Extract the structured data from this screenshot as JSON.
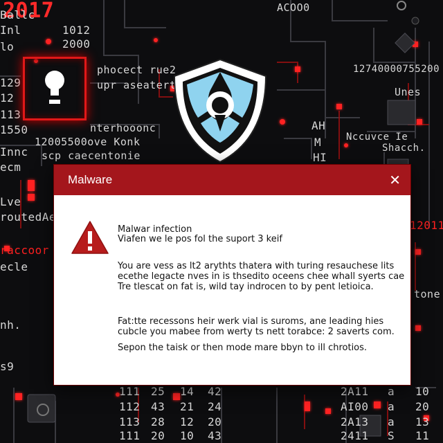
{
  "background": {
    "year": "2017",
    "corner_top_right": "ACOO0",
    "lines_left": [
      "Ballc",
      "Inl",
      "lo",
      "129",
      "12",
      "113",
      "1550",
      "Innc",
      "ecm",
      "Lve",
      "routedAec",
      "raccoor",
      "ecle",
      "nh.",
      "s9"
    ],
    "col_numbers": [
      "1012",
      "2000"
    ],
    "text_mid_left": [
      "phocect rue2",
      "upr aseaterto",
      "nterhooonc",
      "12005500ove Konk",
      "scp caecentonie"
    ],
    "text_right": [
      "12740000755200",
      "Unes",
      "Nccuvce Ie",
      "Shacch.",
      "12011",
      "tone"
    ],
    "ahm_letters": [
      "AH",
      "M",
      "HI"
    ],
    "bottom_row_1": [
      "111",
      "25",
      "14",
      "42",
      "2A11",
      "a",
      "10"
    ],
    "bottom_row_2": [
      "112",
      "43",
      "21",
      "24",
      "AI00",
      "a",
      "20"
    ],
    "bottom_row_3": [
      "113",
      "28",
      "12",
      "20",
      "2A13",
      "a",
      "13"
    ],
    "bottom_row_4": [
      "111",
      "20",
      "10",
      "43",
      "2411",
      "S",
      "11"
    ],
    "accent_red": "#ff2020",
    "titlebar_color": "#a4161c"
  },
  "dialog": {
    "title": "Malware",
    "close_icon": "close-icon",
    "warning_icon": "warning-triangle-icon",
    "heading": "Malwar infection",
    "subheading": "Viafen we le pos fol the suport 3 keif",
    "paragraph1": "You are vess as lt2 arythts thatera with turing resauchese lits ecethe legacte nves in is thsedito oceens chee whall syerts cae Tre tlescat on fat is, wild tay indrocen to by pent letioica.",
    "paragraph2": "Fat:tte recessons heir werk vial is suroms, ane leading hies cubcle you mabee from werty ts nett torabce: 2 saverts com.",
    "paragraph3": "Sepon the taisk or then mode mare bbyn to ill chrotios."
  }
}
